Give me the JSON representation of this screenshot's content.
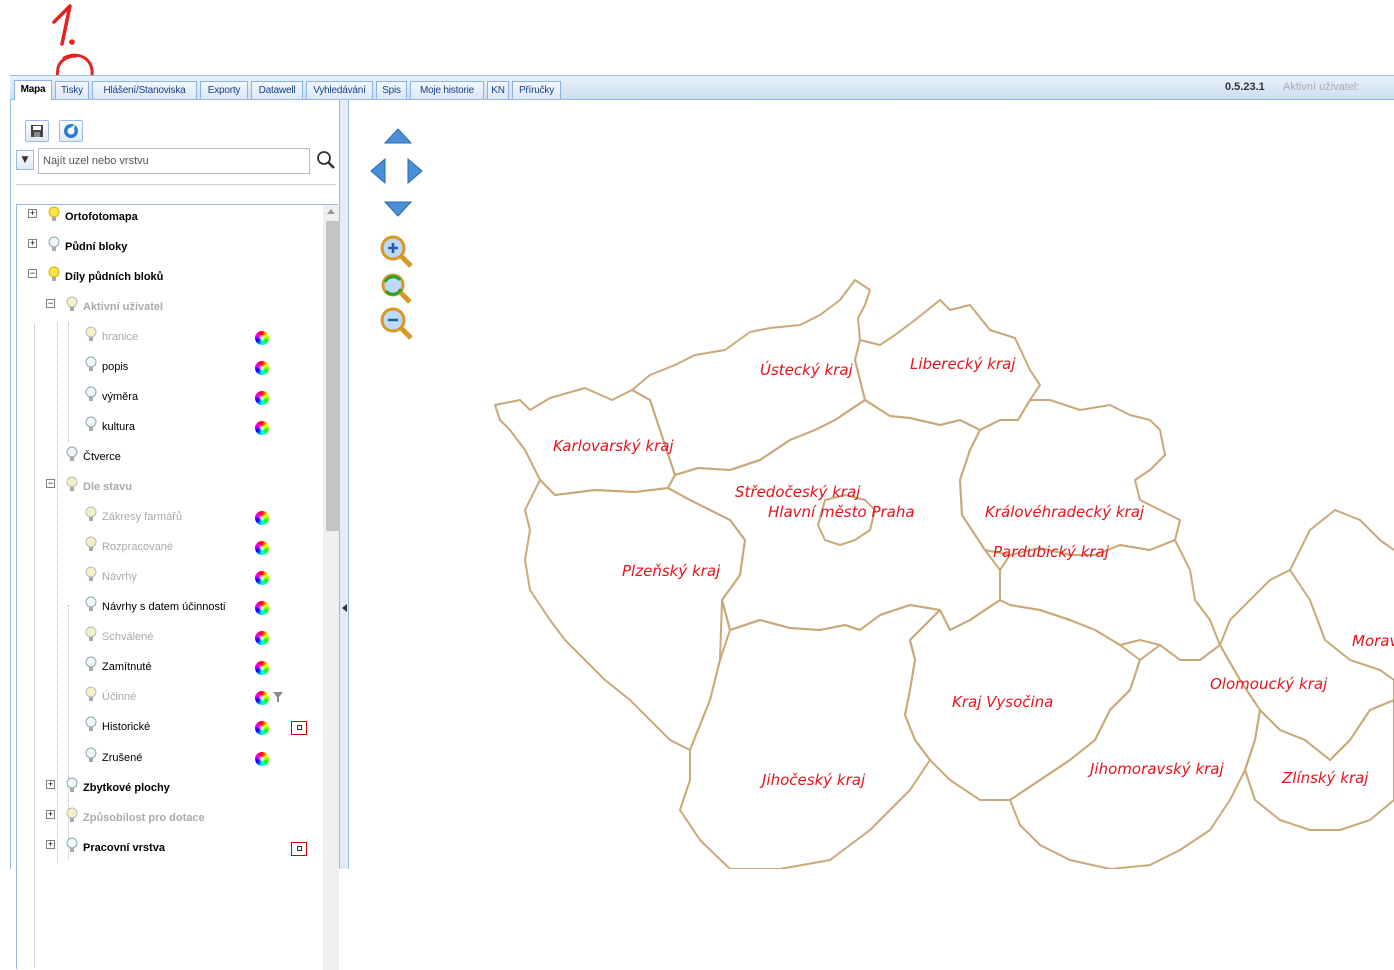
{
  "annotation": {
    "step_label": "1."
  },
  "tabs": [
    {
      "label": "Mapa",
      "active": true
    },
    {
      "label": "Tisky",
      "active": false
    },
    {
      "label": "Hlášení/Stanoviska",
      "active": false
    },
    {
      "label": "Exporty",
      "active": false
    },
    {
      "label": "Datawell",
      "active": false
    },
    {
      "label": "Vyhledávání",
      "active": false
    },
    {
      "label": "Spis",
      "active": false
    },
    {
      "label": "Moje historie",
      "active": false
    },
    {
      "label": "KN",
      "active": false
    },
    {
      "label": "Příručky",
      "active": false
    }
  ],
  "header": {
    "version": "0.5.23.1",
    "active_user_label": "Aktivní uživatel:"
  },
  "toolbar": {
    "save_icon": "save-icon",
    "refresh_icon": "refresh-icon"
  },
  "search": {
    "placeholder": "Najít uzel nebo vrstvu",
    "value": ""
  },
  "tree": {
    "ortofotomapa": "Ortofotomapa",
    "pudni_bloky": "Půdní bloky",
    "dily_pudnich_bloku": "Díly půdních bloků",
    "aktivni_uzivatel": "Aktivní uživatel",
    "hranice": "hranice",
    "popis": "popis",
    "vymera": "výměra",
    "kultura": "kultura",
    "ctverce": "Čtverce",
    "dle_stavu": "Dle stavu",
    "zakresy": "Zákresy farmářů",
    "rozpracovane": "Rozpracované",
    "navrhy": "Návrhy",
    "navrhy_datum": "Návrhy s datem účinnosti",
    "schvalene": "Schválené",
    "zamitnute": "Zamítnuté",
    "ucinne": "Účinné",
    "historicke": "Historické",
    "zrusene": "Zrušené",
    "zbytkove": "Zbytkové plochy",
    "zpusobilost": "Způsobilost pro dotace",
    "pracovni": "Pracovní vrstva"
  },
  "map": {
    "regions": {
      "ustecky": "Ústecký kraj",
      "liberecky": "Liberecký kraj",
      "karlovarsky": "Karlovarský kraj",
      "stredocesky": "Středočeský kraj",
      "praha": "Hlavní město Praha",
      "kralovehradecky": "Královéhradecký kraj",
      "pardubicky": "Pardubický kraj",
      "plzensky": "Plzeňský kraj",
      "moravskoslezsky": "Morav",
      "olomoucky": "Olomoucký kraj",
      "vysocina": "Kraj Vysočina",
      "jihomoravsky": "Jihomoravský kraj",
      "zlinsky": "Zlínský kraj",
      "jihocesky": "Jihočeský kraj"
    },
    "label_color": "#e8121c",
    "border_color": "#c9a97a"
  }
}
